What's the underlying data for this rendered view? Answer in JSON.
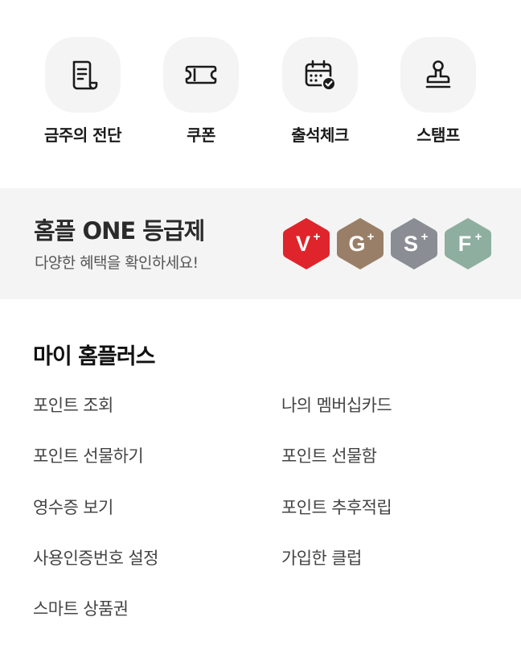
{
  "quick_menu": [
    {
      "label": "금주의 전단",
      "icon": "flyer-icon"
    },
    {
      "label": "쿠폰",
      "icon": "coupon-icon"
    },
    {
      "label": "출석체크",
      "icon": "calendar-check-icon"
    },
    {
      "label": "스탬프",
      "icon": "stamp-icon"
    }
  ],
  "grade_banner": {
    "title": "홈플 ONE 등급제",
    "subtitle": "다양한 혜택을 확인하세요!",
    "badges": [
      {
        "letter": "V",
        "sup": "+",
        "color": "#e0242b"
      },
      {
        "letter": "G",
        "sup": "+",
        "color": "#9a7f68"
      },
      {
        "letter": "S",
        "sup": "+",
        "color": "#8a8d94"
      },
      {
        "letter": "F",
        "sup": "+",
        "color": "#8eae9f"
      }
    ]
  },
  "my_homeplus": {
    "title": "마이 홈플러스",
    "left": [
      "포인트 조회",
      "포인트 선물하기",
      "영수증 보기",
      "사용인증번호 설정",
      "스마트 상품권"
    ],
    "right": [
      "나의 멤버십카드",
      "포인트 선물함",
      "포인트 추후적립",
      "가입한 클럽"
    ]
  }
}
